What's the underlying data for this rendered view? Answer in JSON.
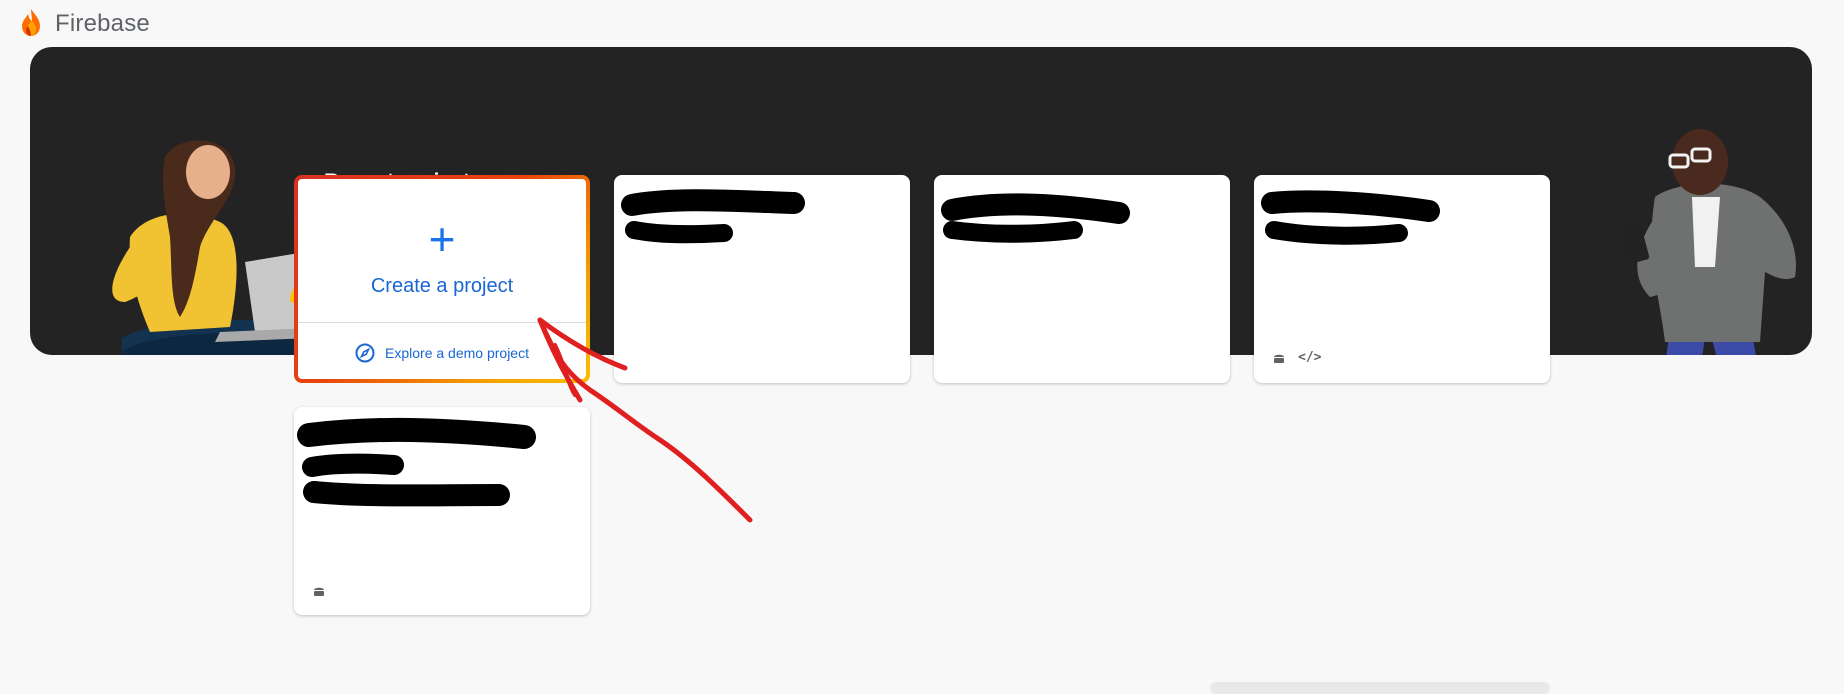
{
  "app": {
    "brand": "Firebase"
  },
  "hero": {
    "section_title": "Recent projects"
  },
  "create_card": {
    "plus_symbol": "+",
    "label": "Create a project",
    "explore_label": "Explore a demo project"
  },
  "colors": {
    "accent_blue": "#1967d2",
    "hero_bg": "#232323",
    "annotation_red": "#e02020"
  },
  "projects": [
    {
      "name_redacted": true,
      "platforms": []
    },
    {
      "name_redacted": true,
      "platforms": []
    },
    {
      "name_redacted": true,
      "platforms": [
        "android-icon",
        "code-icon"
      ]
    },
    {
      "name_redacted": true,
      "platforms": [
        "android-icon"
      ]
    }
  ],
  "icons": {
    "code_glyph": "</>"
  }
}
